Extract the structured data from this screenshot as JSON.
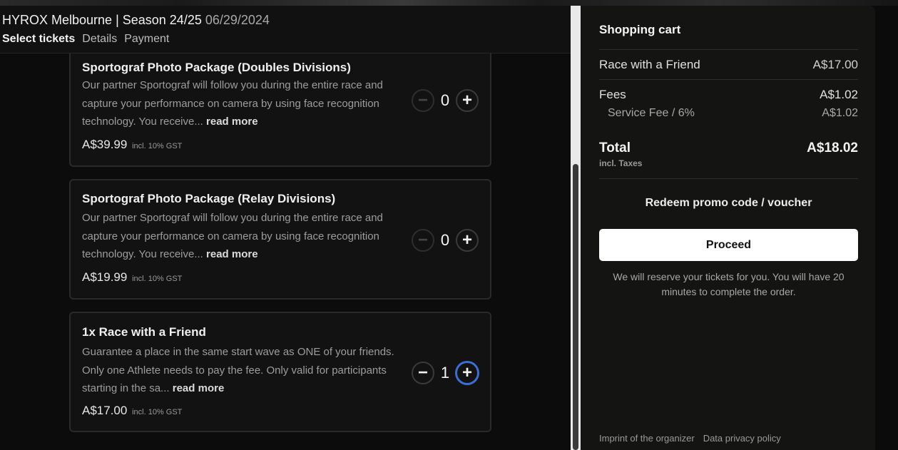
{
  "event": {
    "title": "HYROX Melbourne | Season 24/25",
    "date": "06/29/2024"
  },
  "steps": [
    "Select tickets",
    "Details",
    "Payment"
  ],
  "tickets": [
    {
      "title": "Sportograf Photo Package (Doubles Divisions)",
      "description": "Our partner Sportograf will follow you during the entire race and capture your performance on camera by using face recognition technology. You receive...",
      "read_more": "read more",
      "price": "A$39.99",
      "gst": "incl. 10% GST",
      "quantity": "0",
      "minus": "−",
      "plus": "+"
    },
    {
      "title": "Sportograf Photo Package (Relay Divisions)",
      "description": "Our partner Sportograf will follow you during the entire race and capture your performance on camera by using face recognition technology. You receive...",
      "read_more": "read more",
      "price": "A$19.99",
      "gst": "incl. 10% GST",
      "quantity": "0",
      "minus": "−",
      "plus": "+"
    },
    {
      "title": "1x Race with a Friend",
      "description": "Guarantee a place in the same start wave as ONE of your friends. Only one Athlete needs to pay the fee. Only valid for participants starting in the sa...",
      "read_more": "read more",
      "price": "A$17.00",
      "gst": "incl. 10% GST",
      "quantity": "1",
      "minus": "−",
      "plus": "+"
    }
  ],
  "cart": {
    "title": "Shopping cart",
    "item_label": "Race with a Friend",
    "item_amount": "A$17.00",
    "fees_label": "Fees",
    "fees_amount": "A$1.02",
    "service_fee_label": "Service Fee / 6%",
    "service_fee_amount": "A$1.02",
    "total_label": "Total",
    "total_amount": "A$18.02",
    "incl_taxes": "incl. Taxes",
    "promo": "Redeem promo code / voucher",
    "proceed": "Proceed",
    "reserve_note": "We will reserve your tickets for you. You will have 20 minutes to complete the order.",
    "footer_imprint": "Imprint of the organizer",
    "footer_privacy": "Data privacy policy"
  }
}
